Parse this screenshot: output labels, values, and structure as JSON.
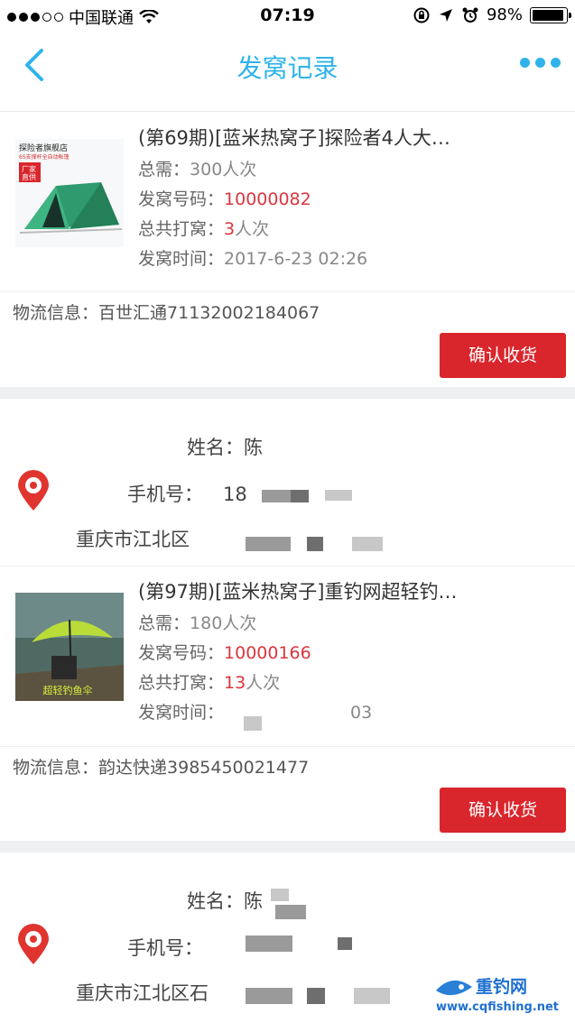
{
  "status_bar": {
    "carrier": "中国联通",
    "time": "07:19",
    "battery": "98%"
  },
  "nav": {
    "title": "发窝记录"
  },
  "orders": [
    {
      "title": "(第69期)[蓝米热窝子]探险者4人大…",
      "total_need_label": "总需：",
      "total_need_value": "300人次",
      "code_label": "发窝号码：",
      "code_value": "10000082",
      "hits_label": "总共打窝：",
      "hits_value_num": "3",
      "hits_value_unit": "人次",
      "time_label": "发窝时间：",
      "time_value": "2017-6-23 02:26",
      "logistics_label": "物流信息：",
      "logistics_value": "百世汇通71132002184067",
      "confirm_label": "确认收货",
      "thumb_text": {
        "store": "探险者旗舰店",
        "tagline": "6S支撑杆全自动帐篷",
        "badge_top": "厂家",
        "badge_bottom": "直供"
      }
    },
    {
      "title": "(第97期)[蓝米热窝子]重钓网超轻钓…",
      "total_need_label": "总需：",
      "total_need_value": "180人次",
      "code_label": "发窝号码：",
      "code_value": "10000166",
      "hits_label": "总共打窝：",
      "hits_value_num": "13",
      "hits_value_unit": "人次",
      "time_label": "发窝时间：",
      "time_value": "03",
      "logistics_label": "物流信息：",
      "logistics_value": "韵达快递3985450021477",
      "confirm_label": "确认收货",
      "thumb_text": {
        "caption": "超轻钓鱼伞"
      }
    }
  ],
  "addresses": [
    {
      "name_label": "姓名：",
      "name_value": "陈",
      "phone_label": "手机号：",
      "phone_value": "18",
      "address": "重庆市江北区"
    },
    {
      "name_label": "姓名：",
      "name_value": "陈",
      "phone_label": "手机号：",
      "phone_value": "",
      "address": "重庆市江北区石"
    }
  ],
  "watermark": {
    "brand": "重钓网",
    "url": "www.cqfishing.net"
  },
  "colors": {
    "accent": "#2fb3ea",
    "button": "#d9262c",
    "highlight": "#d9363e"
  }
}
